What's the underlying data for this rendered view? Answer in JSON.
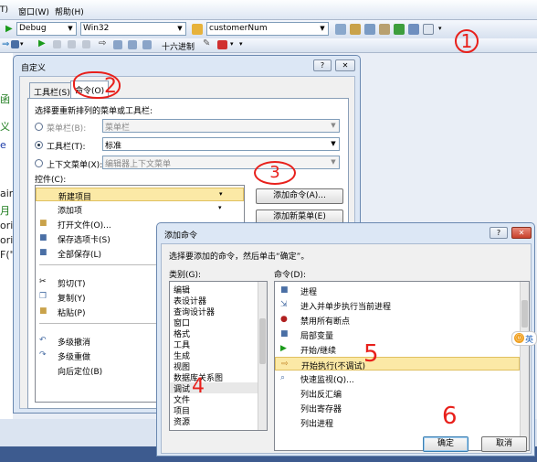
{
  "menubar": {
    "items": [
      "T)",
      "窗口(W)",
      "帮助(H)"
    ]
  },
  "toolbar": {
    "config": "Debug",
    "platform": "Win32",
    "find_value": "customerNum",
    "hex_label": "十六进制"
  },
  "editor": {
    "lines": [
      "函",
      "义",
      "e",
      "air",
      "月",
      "orin",
      "orin",
      "F(\""
    ]
  },
  "customize_dialog": {
    "title": "自定义",
    "help_btn": "?",
    "close_btn": "✕",
    "tabs": [
      "工具栏(S)",
      "命令(O)"
    ],
    "prompt": "选择要重新排列的菜单或工具栏:",
    "radio_menubar": "菜单栏(B):",
    "radio_menubar_value": "菜单栏",
    "radio_toolbar": "工具栏(T):",
    "radio_toolbar_value": "标准",
    "radio_context": "上下文菜单(X):",
    "radio_context_value": "编辑器上下文菜单",
    "controls_label": "控件(C):",
    "controls": [
      "新建项目",
      "添加项",
      "打开文件(O)...",
      "保存选项卡(S)",
      "全部保存(L)",
      "剪切(T)",
      "复制(Y)",
      "粘贴(P)",
      "多级撤消",
      "多级重做",
      "向后定位(B)"
    ],
    "add_command_btn": "添加命令(A)...",
    "add_new_menu_btn": "添加新菜单(E)"
  },
  "add_command_dialog": {
    "title": "添加命令",
    "help_btn": "?",
    "close_btn": "✕",
    "prompt": "选择要添加的命令，然后单击“确定”。",
    "categories_label": "类别(G):",
    "categories": [
      "编辑",
      "表设计器",
      "查询设计器",
      "窗口",
      "格式",
      "工具",
      "生成",
      "视图",
      "数据库关系图",
      "调试",
      "文件",
      "项目",
      "资源"
    ],
    "selected_category": "调试",
    "commands_label": "命令(D):",
    "commands": [
      "进程",
      "进入并单步执行当前进程",
      "禁用所有断点",
      "局部变量",
      "开始/继续",
      "开始执行(不调试)",
      "快速监视(Q)...",
      "列出反汇编",
      "列出寄存器",
      "列出进程"
    ],
    "selected_command": "开始执行(不调试)",
    "ok_btn": "确定",
    "cancel_btn": "取消"
  },
  "annotations": [
    "1",
    "2",
    "3",
    "4",
    "5",
    "6"
  ],
  "ime_label": "英",
  "colors": {
    "annotation": "#e8201b",
    "selection": "#fbe9a6",
    "title_bar": "#dce7f5"
  }
}
